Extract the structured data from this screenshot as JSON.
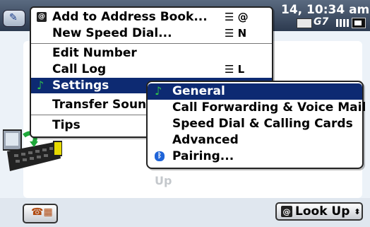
{
  "status": {
    "clock": "14, 10:34 am",
    "network": "G7",
    "keyboard_icon": "keyboard-icon",
    "signal_icon": "signal-bars-icon",
    "battery_icon": "battery-icon"
  },
  "background": {
    "partial_text": "Up",
    "chevron": "›"
  },
  "menu": {
    "items": [
      {
        "label": "Add to Address Book...",
        "shortcut": "☰ @",
        "icon": "address-book-icon"
      },
      {
        "label": "New Speed Dial...",
        "shortcut": "☰ N",
        "icon": ""
      },
      {
        "label": "Edit Number",
        "shortcut": "",
        "icon": ""
      },
      {
        "label": "Call Log",
        "shortcut": "☰ L",
        "icon": ""
      },
      {
        "label": "Settings",
        "shortcut": "",
        "icon": "music-note-icon"
      },
      {
        "label": "Transfer Soun",
        "shortcut": "",
        "icon": ""
      },
      {
        "label": "Tips",
        "shortcut": "",
        "icon": ""
      }
    ]
  },
  "submenu": {
    "items": [
      {
        "label": "General",
        "icon": "music-note-icon"
      },
      {
        "label": "Call Forwarding & Voice Mail",
        "icon": ""
      },
      {
        "label": "Speed Dial & Calling Cards",
        "icon": ""
      },
      {
        "label": "Advanced",
        "icon": ""
      },
      {
        "label": "Pairing...",
        "icon": "bluetooth-icon"
      }
    ]
  },
  "bottombar": {
    "lookup_label": "Look Up",
    "lookup_arrow": "⬍",
    "dialpad_icon": "dialpad-icon"
  },
  "colors": {
    "selection": "#0d2a72",
    "titlebar": "#2c3a4f",
    "accent_green": "#2fc44a"
  }
}
